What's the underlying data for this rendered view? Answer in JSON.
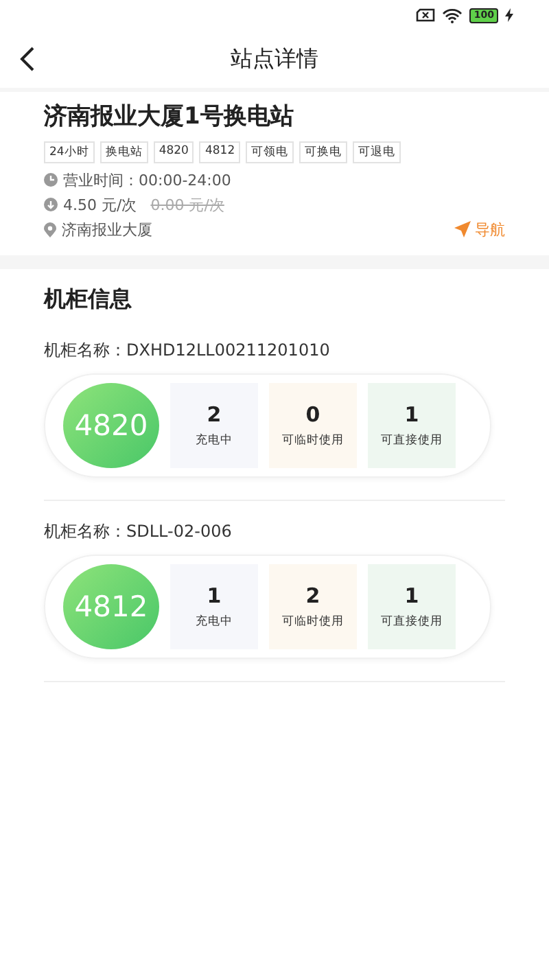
{
  "status_bar": {
    "battery_text": "100"
  },
  "header": {
    "title": "站点详情"
  },
  "station": {
    "name": "济南报业大厦1号换电站",
    "tags": [
      "24小时",
      "换电站",
      "4820",
      "4812",
      "可领电",
      "可换电",
      "可退电"
    ],
    "hours": "营业时间：00:00-24:00",
    "price": "4.50 元/次",
    "original_price": "0.00 元/次",
    "address": "济南报业大厦",
    "navigate": "导航"
  },
  "cabinets": {
    "title": "机柜信息",
    "items": [
      {
        "name": "机柜名称：DXHD12LL00211201010",
        "model": "4820",
        "stats": [
          {
            "kind": "charging",
            "count": "2",
            "label": "充电中"
          },
          {
            "kind": "temporary",
            "count": "0",
            "label": "可临时使用"
          },
          {
            "kind": "direct",
            "count": "1",
            "label": "可直接使用"
          }
        ]
      },
      {
        "name": "机柜名称：SDLL-02-006",
        "model": "4812",
        "stats": [
          {
            "kind": "charging",
            "count": "1",
            "label": "充电中"
          },
          {
            "kind": "temporary",
            "count": "2",
            "label": "可临时使用"
          },
          {
            "kind": "direct",
            "count": "1",
            "label": "可直接使用"
          }
        ]
      }
    ]
  }
}
